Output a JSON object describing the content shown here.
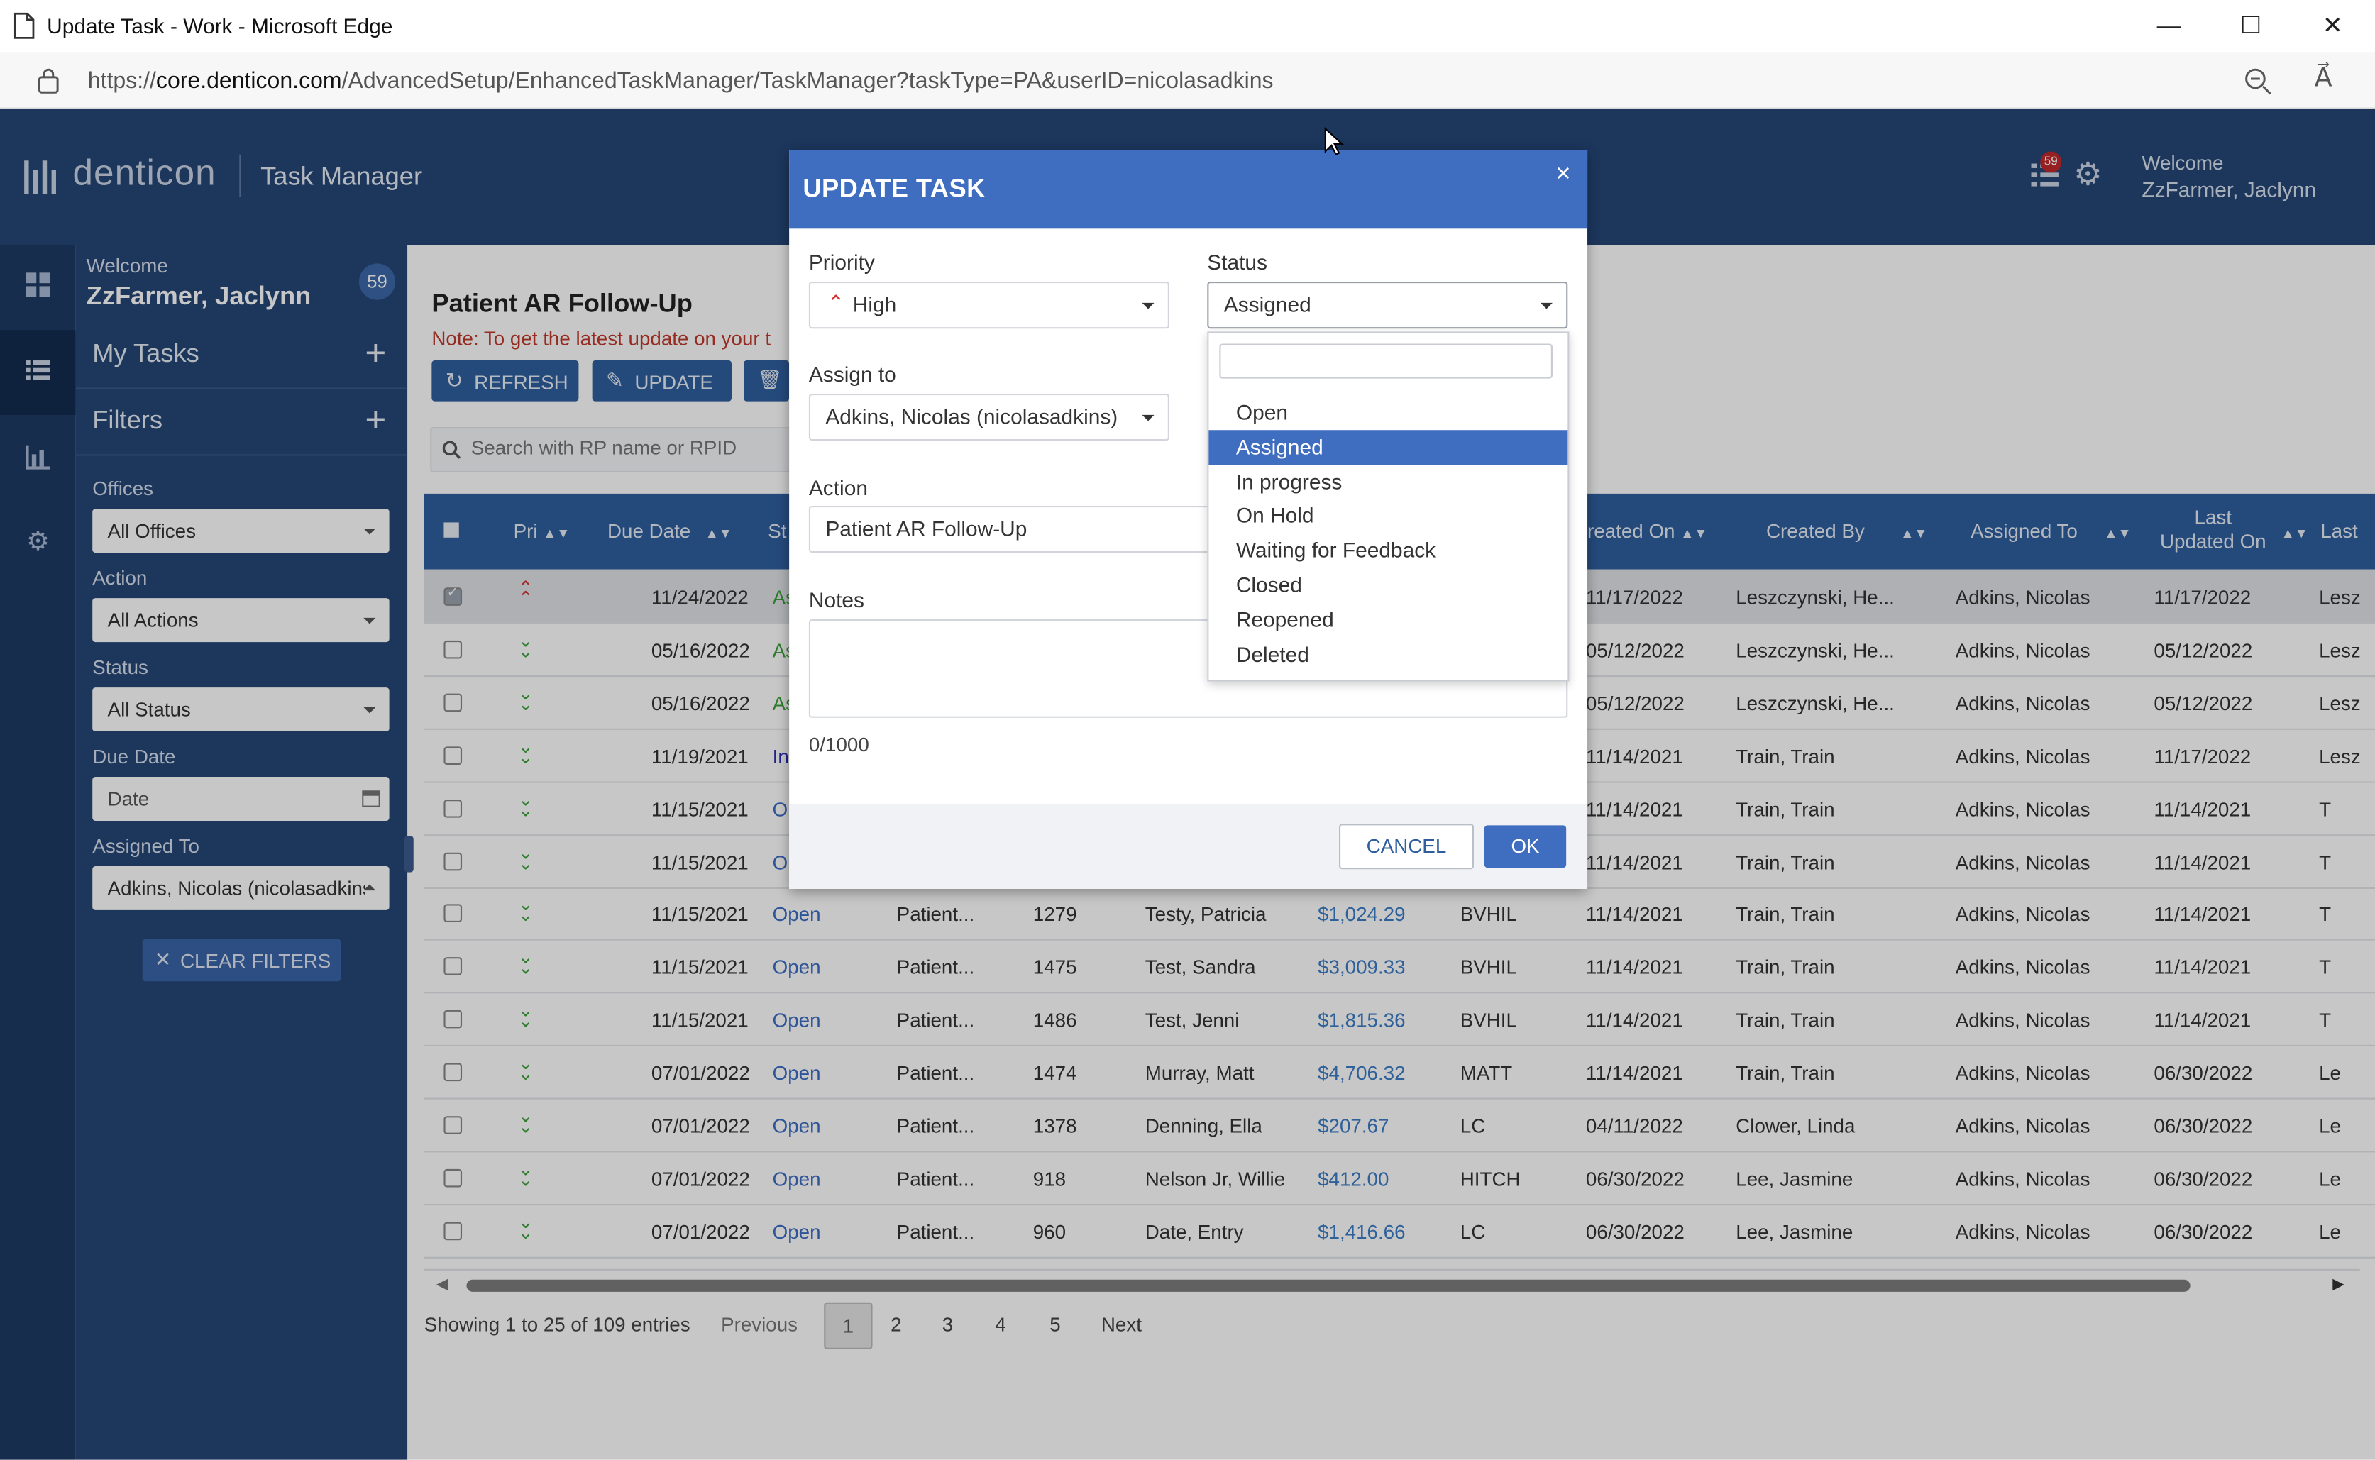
{
  "browser": {
    "title": "Update Task - Work - Microsoft Edge",
    "url_prefix": "https://",
    "url_host": "core.denticon.com",
    "url_path": "/AdvancedSetup/EnhancedTaskManager/TaskManager?taskType=PA&userID=nicolasadkins"
  },
  "header": {
    "logo": "denticon",
    "app_title": "Task Manager",
    "welcome": "Welcome",
    "user": "ZzFarmer, Jaclynn",
    "notif_count": "59"
  },
  "sidebar": {
    "welcome": "Welcome",
    "user": "ZzFarmer, Jaclynn",
    "badge": "59",
    "my_tasks": "My Tasks",
    "filters": "Filters",
    "offices_label": "Offices",
    "offices_value": "All Offices",
    "action_label": "Action",
    "action_value": "All Actions",
    "status_label": "Status",
    "status_value": "All Status",
    "due_label": "Due Date",
    "due_value": "Date",
    "assigned_label": "Assigned To",
    "assigned_value": "Adkins, Nicolas (nicolasadkins)",
    "clear": "CLEAR FILTERS"
  },
  "main": {
    "title": "Patient AR Follow-Up",
    "note": "Note: To get the latest update on your t",
    "refresh": "REFRESH",
    "update": "UPDATE",
    "search_placeholder": "Search with RP name or RPID",
    "columns": {
      "pri": "Pri",
      "due": "Due Date",
      "st": "St",
      "created_on": "reated On",
      "created_by": "Created By",
      "assigned_to": "Assigned To",
      "last_updated_1": "Last",
      "last_updated_2": "Updated On",
      "last": "Last"
    },
    "rows": [
      {
        "pri": "high",
        "due": "11/24/2022",
        "status": "Ass",
        "action": "",
        "rpid": "",
        "name": "",
        "amount": "",
        "office": "",
        "created_on": "11/17/2022",
        "created_by": "Leszczynski, He...",
        "assigned": "Adkins, Nicolas",
        "updated": "11/17/2022",
        "last": "Lesz",
        "checked": true
      },
      {
        "pri": "low",
        "due": "05/16/2022",
        "status": "Ass",
        "action": "",
        "rpid": "",
        "name": "",
        "amount": "",
        "office": "",
        "created_on": "05/12/2022",
        "created_by": "Leszczynski, He...",
        "assigned": "Adkins, Nicolas",
        "updated": "05/12/2022",
        "last": "Lesz"
      },
      {
        "pri": "low",
        "due": "05/16/2022",
        "status": "Ass",
        "action": "",
        "rpid": "",
        "name": "",
        "amount": "",
        "office": "",
        "created_on": "05/12/2022",
        "created_by": "Leszczynski, He...",
        "assigned": "Adkins, Nicolas",
        "updated": "05/12/2022",
        "last": "Lesz"
      },
      {
        "pri": "low",
        "due": "11/19/2021",
        "status": "In p",
        "action": "",
        "rpid": "",
        "name": "",
        "amount": "",
        "office": "",
        "created_on": "11/14/2021",
        "created_by": "Train, Train",
        "assigned": "Adkins, Nicolas",
        "updated": "11/17/2022",
        "last": "Lesz"
      },
      {
        "pri": "low",
        "due": "11/15/2021",
        "status": "O",
        "action": "",
        "rpid": "",
        "name": "",
        "amount": "",
        "office": "",
        "created_on": "11/14/2021",
        "created_by": "Train, Train",
        "assigned": "Adkins, Nicolas",
        "updated": "11/14/2021",
        "last": "T"
      },
      {
        "pri": "low",
        "due": "11/15/2021",
        "status": "O",
        "action": "",
        "rpid": "",
        "name": "",
        "amount": "",
        "office": "",
        "created_on": "11/14/2021",
        "created_by": "Train, Train",
        "assigned": "Adkins, Nicolas",
        "updated": "11/14/2021",
        "last": "T"
      },
      {
        "pri": "low",
        "due": "11/15/2021",
        "status": "Open",
        "action": "Patient...",
        "rpid": "1279",
        "name": "Testy, Patricia",
        "amount": "$1,024.29",
        "office": "BVHIL",
        "created_on": "11/14/2021",
        "created_by": "Train, Train",
        "assigned": "Adkins, Nicolas",
        "updated": "11/14/2021",
        "last": "T"
      },
      {
        "pri": "low",
        "due": "11/15/2021",
        "status": "Open",
        "action": "Patient...",
        "rpid": "1475",
        "name": "Test, Sandra",
        "amount": "$3,009.33",
        "office": "BVHIL",
        "created_on": "11/14/2021",
        "created_by": "Train, Train",
        "assigned": "Adkins, Nicolas",
        "updated": "11/14/2021",
        "last": "T"
      },
      {
        "pri": "low",
        "due": "11/15/2021",
        "status": "Open",
        "action": "Patient...",
        "rpid": "1486",
        "name": "Test, Jenni",
        "amount": "$1,815.36",
        "office": "BVHIL",
        "created_on": "11/14/2021",
        "created_by": "Train, Train",
        "assigned": "Adkins, Nicolas",
        "updated": "11/14/2021",
        "last": "T"
      },
      {
        "pri": "low",
        "due": "07/01/2022",
        "status": "Open",
        "action": "Patient...",
        "rpid": "1474",
        "name": "Murray, Matt",
        "amount": "$4,706.32",
        "office": "MATT",
        "created_on": "11/14/2021",
        "created_by": "Train, Train",
        "assigned": "Adkins, Nicolas",
        "updated": "06/30/2022",
        "last": "Le"
      },
      {
        "pri": "low",
        "due": "07/01/2022",
        "status": "Open",
        "action": "Patient...",
        "rpid": "1378",
        "name": "Denning, Ella",
        "amount": "$207.67",
        "office": "LC",
        "created_on": "04/11/2022",
        "created_by": "Clower, Linda",
        "assigned": "Adkins, Nicolas",
        "updated": "06/30/2022",
        "last": "Le"
      },
      {
        "pri": "low",
        "due": "07/01/2022",
        "status": "Open",
        "action": "Patient...",
        "rpid": "918",
        "name": "Nelson Jr, Willie",
        "amount": "$412.00",
        "office": "HITCH",
        "created_on": "06/30/2022",
        "created_by": "Lee, Jasmine",
        "assigned": "Adkins, Nicolas",
        "updated": "06/30/2022",
        "last": "Le"
      },
      {
        "pri": "low",
        "due": "07/01/2022",
        "status": "Open",
        "action": "Patient...",
        "rpid": "960",
        "name": "Date, Entry",
        "amount": "$1,416.66",
        "office": "LC",
        "created_on": "06/30/2022",
        "created_by": "Lee, Jasmine",
        "assigned": "Adkins, Nicolas",
        "updated": "06/30/2022",
        "last": "Le"
      }
    ],
    "showing": "Showing 1 to 25 of 109 entries",
    "previous": "Previous",
    "pages": [
      "1",
      "2",
      "3",
      "4",
      "5"
    ],
    "next": "Next"
  },
  "modal": {
    "title": "UPDATE TASK",
    "close": "×",
    "priority_label": "Priority",
    "priority_value": "High",
    "status_label": "Status",
    "status_value": "Assigned",
    "assign_label": "Assign to",
    "assign_value": "Adkins, Nicolas (nicolasadkins)",
    "action_label": "Action",
    "action_value": "Patient AR Follow-Up",
    "notes_label": "Notes",
    "notes_count": "0/1000",
    "cancel": "CANCEL",
    "ok": "OK",
    "status_options": [
      "Open",
      "Assigned",
      "In progress",
      "On Hold",
      "Waiting for Feedback",
      "Closed",
      "Reopened",
      "Deleted"
    ],
    "status_selected": "Assigned"
  },
  "colors": {
    "header": "#254677",
    "table_header": "#2f5e9e",
    "modal_header": "#3f6dc0",
    "priority_high": "#d0312d",
    "priority_low": "#3aa13a"
  }
}
